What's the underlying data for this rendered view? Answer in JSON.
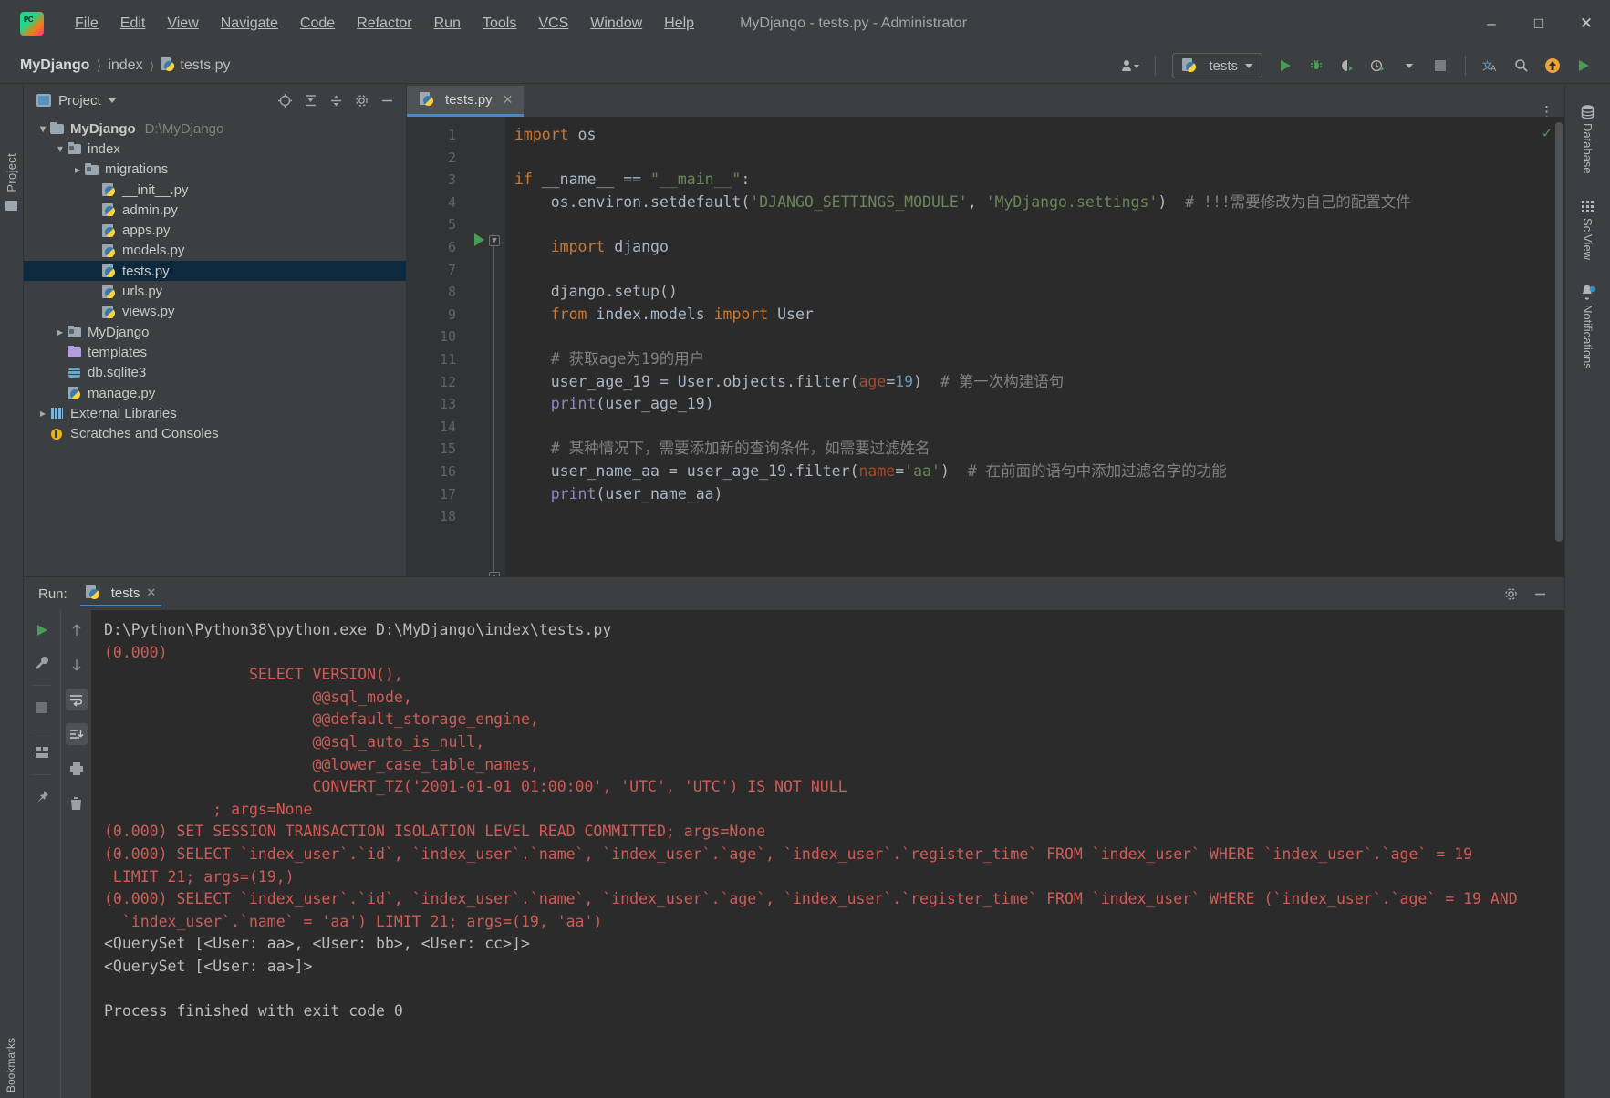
{
  "window": {
    "title": "MyDjango - tests.py - Administrator",
    "logo_icon": "pycharm-logo-icon",
    "minimize_icon": "minimize-icon",
    "maximize_icon": "maximize-icon",
    "close_icon": "close-icon"
  },
  "menu": [
    {
      "label": "File"
    },
    {
      "label": "Edit"
    },
    {
      "label": "View"
    },
    {
      "label": "Navigate"
    },
    {
      "label": "Code"
    },
    {
      "label": "Refactor"
    },
    {
      "label": "Run"
    },
    {
      "label": "Tools"
    },
    {
      "label": "VCS"
    },
    {
      "label": "Window"
    },
    {
      "label": "Help"
    }
  ],
  "breadcrumb": {
    "project": "MyDjango",
    "folder": "index",
    "file": "tests.py"
  },
  "toolbar": {
    "run_config": "tests",
    "icons": [
      "user-icon",
      "python-icon",
      "run-icon",
      "debug-icon",
      "coverage-icon",
      "profile-icon",
      "stop-icon",
      "translate-icon",
      "search-icon",
      "update-icon",
      "play-icon"
    ]
  },
  "left_rail": {
    "label": "Project",
    "bottom_label": "Bookmarks"
  },
  "right_rail": [
    {
      "label": "Database",
      "icon": "database-icon"
    },
    {
      "label": "SciView",
      "icon": "grid-icon"
    },
    {
      "label": "Notifications",
      "icon": "bell-icon"
    }
  ],
  "project_panel": {
    "title": "Project",
    "header_icons": [
      "locate-icon",
      "expand-all-icon",
      "collapse-all-icon",
      "settings-icon",
      "hide-icon"
    ],
    "tree": [
      {
        "label": "MyDjango",
        "sub": "D:\\MyDjango",
        "depth": 0,
        "arrow": "open",
        "icon": "folder-icon",
        "bold": true,
        "selected": false
      },
      {
        "label": "index",
        "sub": "",
        "depth": 1,
        "arrow": "open",
        "icon": "folder-src-icon",
        "bold": false,
        "selected": false
      },
      {
        "label": "migrations",
        "sub": "",
        "depth": 2,
        "arrow": "closed",
        "icon": "folder-src-icon",
        "bold": false,
        "selected": false
      },
      {
        "label": "__init__.py",
        "sub": "",
        "depth": 3,
        "arrow": "none",
        "icon": "python-file-icon",
        "bold": false,
        "selected": false
      },
      {
        "label": "admin.py",
        "sub": "",
        "depth": 3,
        "arrow": "none",
        "icon": "python-file-icon",
        "bold": false,
        "selected": false
      },
      {
        "label": "apps.py",
        "sub": "",
        "depth": 3,
        "arrow": "none",
        "icon": "python-file-icon",
        "bold": false,
        "selected": false
      },
      {
        "label": "models.py",
        "sub": "",
        "depth": 3,
        "arrow": "none",
        "icon": "python-file-icon",
        "bold": false,
        "selected": false
      },
      {
        "label": "tests.py",
        "sub": "",
        "depth": 3,
        "arrow": "none",
        "icon": "python-file-icon",
        "bold": false,
        "selected": true
      },
      {
        "label": "urls.py",
        "sub": "",
        "depth": 3,
        "arrow": "none",
        "icon": "python-file-icon",
        "bold": false,
        "selected": false
      },
      {
        "label": "views.py",
        "sub": "",
        "depth": 3,
        "arrow": "none",
        "icon": "python-file-icon",
        "bold": false,
        "selected": false
      },
      {
        "label": "MyDjango",
        "sub": "",
        "depth": 1,
        "arrow": "closed",
        "icon": "folder-src-icon",
        "bold": false,
        "selected": false
      },
      {
        "label": "templates",
        "sub": "",
        "depth": 1,
        "arrow": "none",
        "icon": "folder-purple-icon",
        "bold": false,
        "selected": false
      },
      {
        "label": "db.sqlite3",
        "sub": "",
        "depth": 1,
        "arrow": "none",
        "icon": "database-file-icon",
        "bold": false,
        "selected": false
      },
      {
        "label": "manage.py",
        "sub": "",
        "depth": 1,
        "arrow": "none",
        "icon": "python-file-icon",
        "bold": false,
        "selected": false
      },
      {
        "label": "External Libraries",
        "sub": "",
        "depth": 0,
        "arrow": "closed",
        "icon": "library-icon",
        "bold": false,
        "selected": false
      },
      {
        "label": "Scratches and Consoles",
        "sub": "",
        "depth": 0,
        "arrow": "none",
        "icon": "scratch-icon",
        "bold": false,
        "selected": false
      }
    ]
  },
  "editor": {
    "tab": {
      "label": "tests.py",
      "close_icon": "close-icon",
      "file_icon": "python-file-icon"
    },
    "more_icon": "more-options-icon",
    "inspection_status": "✓",
    "line_numbers": [
      "1",
      "2",
      "3",
      "4",
      "5",
      "6",
      "7",
      "8",
      "9",
      "10",
      "11",
      "12",
      "13",
      "14",
      "15",
      "16",
      "17",
      "18"
    ],
    "code_lines": [
      {
        "n": 1,
        "tokens": [
          {
            "t": "import",
            "c": "kw"
          },
          {
            "t": " os",
            "c": "ident"
          }
        ]
      },
      {
        "n": 2,
        "tokens": []
      },
      {
        "n": 3,
        "tokens": [
          {
            "t": "if",
            "c": "kw"
          },
          {
            "t": " __name__ ",
            "c": "ident"
          },
          {
            "t": "==",
            "c": "ident"
          },
          {
            "t": " ",
            "c": "ident"
          },
          {
            "t": "\"__main__\"",
            "c": "str"
          },
          {
            "t": ":",
            "c": "ident"
          }
        ]
      },
      {
        "n": 4,
        "tokens": [
          {
            "t": "    os.environ.setdefault(",
            "c": "ident"
          },
          {
            "t": "'DJANGO_SETTINGS_MODULE'",
            "c": "str"
          },
          {
            "t": ", ",
            "c": "ident"
          },
          {
            "t": "'MyDjango.settings'",
            "c": "str"
          },
          {
            "t": ")  ",
            "c": "ident"
          },
          {
            "t": "# !!!需要修改为自己的配置文件",
            "c": "cmt"
          }
        ]
      },
      {
        "n": 5,
        "tokens": []
      },
      {
        "n": 6,
        "tokens": [
          {
            "t": "    ",
            "c": "ident"
          },
          {
            "t": "import",
            "c": "kw"
          },
          {
            "t": " django",
            "c": "ident"
          }
        ]
      },
      {
        "n": 7,
        "tokens": []
      },
      {
        "n": 8,
        "tokens": [
          {
            "t": "    django.setup()",
            "c": "ident"
          }
        ]
      },
      {
        "n": 9,
        "tokens": [
          {
            "t": "    ",
            "c": "ident"
          },
          {
            "t": "from",
            "c": "kw"
          },
          {
            "t": " index.models ",
            "c": "ident"
          },
          {
            "t": "import",
            "c": "kw"
          },
          {
            "t": " User",
            "c": "ident"
          }
        ]
      },
      {
        "n": 10,
        "tokens": []
      },
      {
        "n": 11,
        "tokens": [
          {
            "t": "    ",
            "c": "ident"
          },
          {
            "t": "# 获取age为19的用户",
            "c": "cmt"
          }
        ]
      },
      {
        "n": 12,
        "tokens": [
          {
            "t": "    user_age_19 = User.objects.filter(",
            "c": "ident"
          },
          {
            "t": "age",
            "c": "kwarg"
          },
          {
            "t": "=",
            "c": "ident"
          },
          {
            "t": "19",
            "c": "num"
          },
          {
            "t": ")  ",
            "c": "ident"
          },
          {
            "t": "# 第一次构建语句",
            "c": "cmt"
          }
        ]
      },
      {
        "n": 13,
        "tokens": [
          {
            "t": "    ",
            "c": "ident"
          },
          {
            "t": "print",
            "c": "bfn"
          },
          {
            "t": "(user_age_19)",
            "c": "ident"
          }
        ]
      },
      {
        "n": 14,
        "tokens": []
      },
      {
        "n": 15,
        "tokens": [
          {
            "t": "    ",
            "c": "ident"
          },
          {
            "t": "# 某种情况下，需要添加新的查询条件，如需要过滤姓名",
            "c": "cmt"
          }
        ]
      },
      {
        "n": 16,
        "tokens": [
          {
            "t": "    user_name_aa = user_age_19.filter(",
            "c": "ident"
          },
          {
            "t": "name",
            "c": "kwarg"
          },
          {
            "t": "=",
            "c": "ident"
          },
          {
            "t": "'aa'",
            "c": "str"
          },
          {
            "t": ")  ",
            "c": "ident"
          },
          {
            "t": "# 在前面的语句中添加过滤名字的功能",
            "c": "cmt"
          }
        ]
      },
      {
        "n": 17,
        "tokens": [
          {
            "t": "    ",
            "c": "ident"
          },
          {
            "t": "print",
            "c": "bfn"
          },
          {
            "t": "(user_name_aa)",
            "c": "ident"
          }
        ]
      },
      {
        "n": 18,
        "tokens": []
      }
    ]
  },
  "run_panel": {
    "label": "Run:",
    "tab": "tests",
    "tab_close_icon": "close-icon",
    "settings_icon": "gear-icon",
    "hide_icon": "minimize-icon",
    "tool_icons": [
      "rerun-icon",
      "wrench-icon",
      "stop-icon",
      "layout-icon",
      "pin-icon"
    ],
    "tool_icons2": [
      "up-arrow-icon",
      "down-arrow-icon",
      "soft-wrap-icon",
      "scroll-to-end-icon",
      "print-icon",
      "trash-icon"
    ],
    "console_lines": [
      {
        "text": "D:\\Python\\Python38\\python.exe D:\\MyDjango\\index\\tests.py",
        "color": "white"
      },
      {
        "text": "(0.000)",
        "color": "red"
      },
      {
        "text": "                SELECT VERSION(),",
        "color": "red"
      },
      {
        "text": "                       @@sql_mode,",
        "color": "red"
      },
      {
        "text": "                       @@default_storage_engine,",
        "color": "red"
      },
      {
        "text": "                       @@sql_auto_is_null,",
        "color": "red"
      },
      {
        "text": "                       @@lower_case_table_names,",
        "color": "red"
      },
      {
        "text": "                       CONVERT_TZ('2001-01-01 01:00:00', 'UTC', 'UTC') IS NOT NULL",
        "color": "red"
      },
      {
        "text": "            ; args=None",
        "color": "red"
      },
      {
        "text": "(0.000) SET SESSION TRANSACTION ISOLATION LEVEL READ COMMITTED; args=None",
        "color": "red"
      },
      {
        "text": "(0.000) SELECT `index_user`.`id`, `index_user`.`name`, `index_user`.`age`, `index_user`.`register_time` FROM `index_user` WHERE `index_user`.`age` = 19",
        "color": "red"
      },
      {
        "text": " LIMIT 21; args=(19,)",
        "color": "red"
      },
      {
        "text": "(0.000) SELECT `index_user`.`id`, `index_user`.`name`, `index_user`.`age`, `index_user`.`register_time` FROM `index_user` WHERE (`index_user`.`age` = 19 AND",
        "color": "red"
      },
      {
        "text": "  `index_user`.`name` = 'aa') LIMIT 21; args=(19, 'aa')",
        "color": "red"
      },
      {
        "text": "<QuerySet [<User: aa>, <User: bb>, <User: cc>]>",
        "color": "white"
      },
      {
        "text": "<QuerySet [<User: aa>]>",
        "color": "white"
      },
      {
        "text": "",
        "color": "white"
      },
      {
        "text": "Process finished with exit code 0",
        "color": "white"
      }
    ]
  },
  "colors": {
    "accent": "#4a88c7",
    "bg_panel": "#3c3f41",
    "bg_editor": "#2b2b2b",
    "selection": "#0d293e",
    "console_sql": "#cf5b56",
    "green_run": "#499c54"
  }
}
